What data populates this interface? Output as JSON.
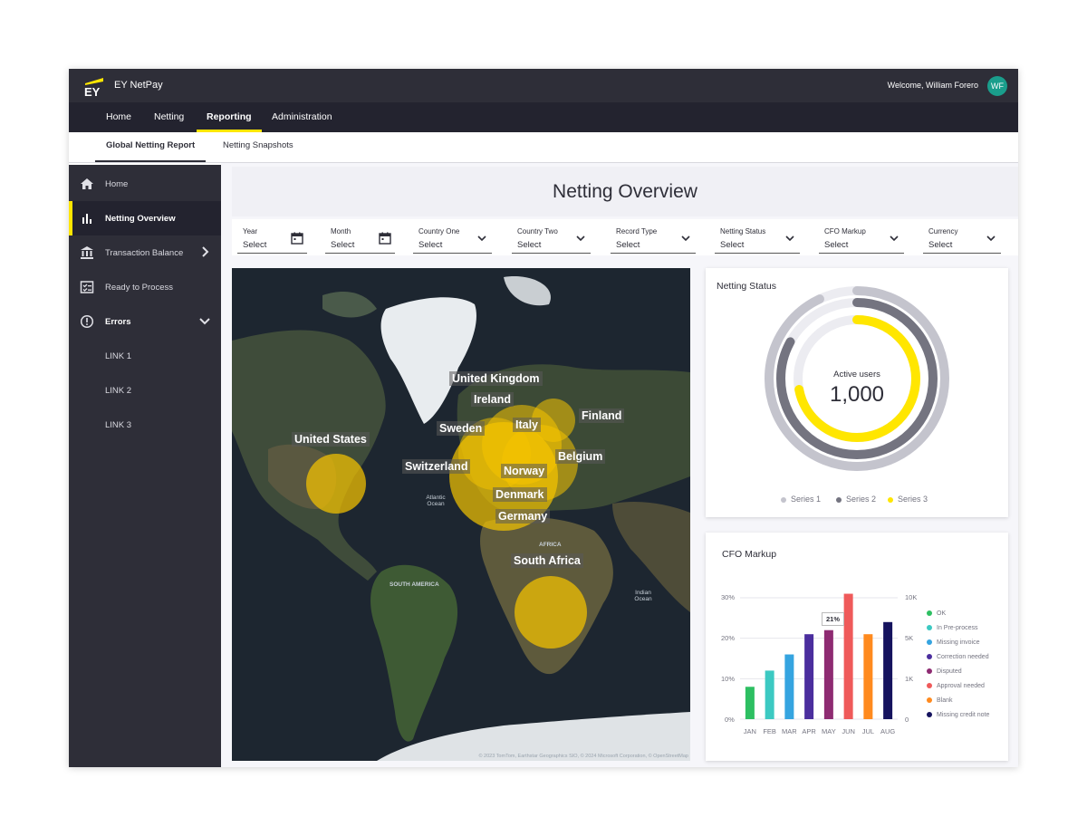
{
  "app": {
    "logo_text": "EY",
    "name": "EY NetPay",
    "welcome": "Welcome, William Forero",
    "avatar_initials": "WF",
    "accent": "#ffe600"
  },
  "nav": {
    "items": [
      {
        "label": "Home"
      },
      {
        "label": "Netting"
      },
      {
        "label": "Reporting",
        "active": true
      },
      {
        "label": "Administration"
      }
    ]
  },
  "subnav": {
    "items": [
      {
        "label": "Global Netting Report",
        "active": true
      },
      {
        "label": "Netting Snapshots"
      }
    ]
  },
  "sidebar": {
    "items": [
      {
        "label": "Home",
        "icon": "home-icon"
      },
      {
        "label": "Netting Overview",
        "icon": "bar-chart-icon",
        "active": true
      },
      {
        "label": "Transaction Balance",
        "icon": "bank-icon"
      },
      {
        "label": "Ready to Process",
        "icon": "checklist-icon"
      },
      {
        "label": "Errors",
        "icon": "alert-circle-icon"
      },
      {
        "label": "LINK 1"
      },
      {
        "label": "LINK 2"
      },
      {
        "label": "LINK 3"
      }
    ]
  },
  "page": {
    "title": "Netting Overview"
  },
  "filters": [
    {
      "label": "Year",
      "value": "Select",
      "icon": "calendar-icon"
    },
    {
      "label": "Month",
      "value": "Select",
      "icon": "calendar-icon"
    },
    {
      "label": "Country One",
      "value": "Select",
      "icon": "chevron-down-icon"
    },
    {
      "label": "Country Two",
      "value": "Select",
      "icon": "chevron-down-icon"
    },
    {
      "label": "Record Type",
      "value": "Select",
      "icon": "chevron-down-icon"
    },
    {
      "label": "Netting Status",
      "value": "Select",
      "icon": "chevron-down-icon"
    },
    {
      "label": "CFO Markup",
      "value": "Select",
      "icon": "chevron-down-icon"
    },
    {
      "label": "Currency",
      "value": "Select",
      "icon": "chevron-down-icon"
    }
  ],
  "map": {
    "countries": [
      "United Kingdom",
      "Ireland",
      "Sweden",
      "Italy",
      "Finland",
      "United States",
      "Belgium",
      "Switzerland",
      "Norway",
      "Denmark",
      "Germany",
      "South Africa"
    ],
    "region_labels": [
      "Atlantic Ocean",
      "AFRICA",
      "SOUTH AMERICA",
      "Indian Ocean"
    ],
    "attribution": "© 2023 TomTom, Earthstar Geographics SIO, © 2024 Microsoft Corporation, © OpenStreetMap"
  },
  "netting_status": {
    "title": "Netting Status",
    "center_label": "Active users",
    "center_value": "1,000",
    "series": [
      {
        "name": "Series 1",
        "color": "#c4c4cd",
        "fraction": 0.93
      },
      {
        "name": "Series 2",
        "color": "#747480",
        "fraction": 0.83
      },
      {
        "name": "Series 3",
        "color": "#ffe600",
        "fraction": 0.72
      }
    ]
  },
  "cfo_markup": {
    "title": "CFO Markup",
    "tooltip": "21%",
    "left_ticks": [
      "30%",
      "20%",
      "10%",
      "0%"
    ],
    "right_ticks": [
      "10K",
      "5K",
      "1K",
      "0"
    ]
  },
  "chart_data": {
    "type": "bar",
    "title": "CFO Markup",
    "categories": [
      "JAN",
      "FEB",
      "MAR",
      "APR",
      "MAY",
      "JUN",
      "JUL",
      "AUG"
    ],
    "values": [
      8,
      12,
      16,
      21,
      22,
      31,
      21,
      24
    ],
    "ylim": [
      0,
      30
    ],
    "legend": [
      {
        "name": "OK",
        "color": "#2dbf62"
      },
      {
        "name": "In Pre-process",
        "color": "#3cc9c2"
      },
      {
        "name": "Missing invoice",
        "color": "#35a4e0"
      },
      {
        "name": "Correction needed",
        "color": "#4b2e9e"
      },
      {
        "name": "Disputed",
        "color": "#8e2b72"
      },
      {
        "name": "Approval needed",
        "color": "#ef5a5a"
      },
      {
        "name": "Blank",
        "color": "#ff8a1e"
      },
      {
        "name": "Missing credit note",
        "color": "#15135e"
      }
    ],
    "legend_placement": "right"
  }
}
